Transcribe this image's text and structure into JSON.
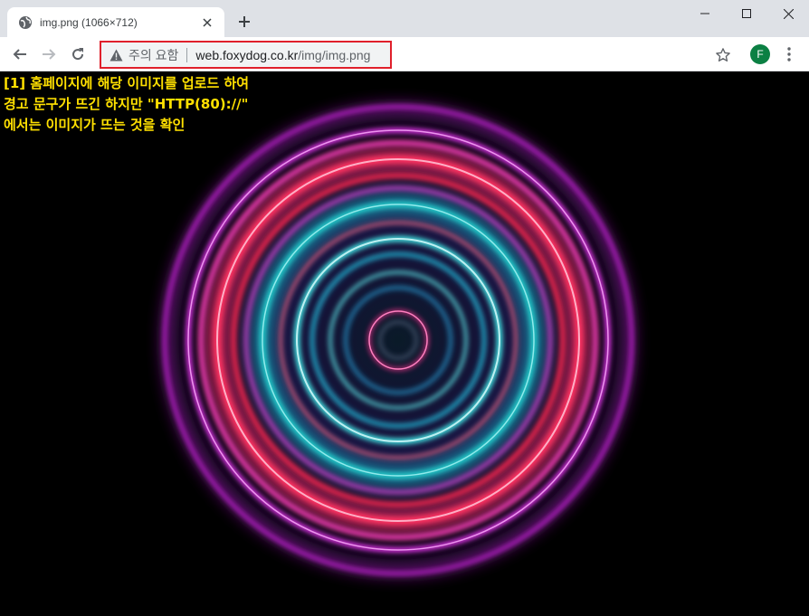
{
  "tab": {
    "title": "img.png (1066×712)",
    "favicon": "globe-icon"
  },
  "window_controls": {
    "minimize": "minimize-icon",
    "maximize": "maximize-icon",
    "close": "close-icon"
  },
  "toolbar": {
    "security_label": "주의 요함",
    "url_host": "web.foxydog.co.kr",
    "url_path": "/img/img.png",
    "avatar_letter": "F",
    "highlight_color": "#e0202b"
  },
  "content": {
    "note_lines": [
      "[1] 홈페이지에 해당 이미지를 업로드 하여",
      "경고 문구가 뜨긴 하지만 \"HTTP(80)://\"",
      "에서는 이미지가 뜨는 것을 확인"
    ],
    "note_color": "#ffe000"
  }
}
